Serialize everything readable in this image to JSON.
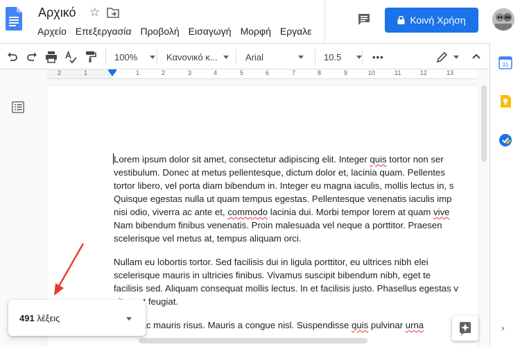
{
  "header": {
    "title": "Αρχικό",
    "menu": [
      "Αρχείο",
      "Επεξεργασία",
      "Προβολή",
      "Εισαγωγή",
      "Μορφή",
      "Εργαλε"
    ],
    "share_label": "Κοινή Χρήση"
  },
  "toolbar": {
    "zoom": "100%",
    "style": "Κανονικό κ...",
    "font": "Arial",
    "font_size": "10.5",
    "more": "•••"
  },
  "ruler": {
    "numbers": [
      "2",
      "1",
      "1",
      "2",
      "3",
      "4",
      "5",
      "6",
      "7",
      "8",
      "9",
      "10",
      "11",
      "12",
      "13"
    ]
  },
  "document": {
    "paragraphs": [
      {
        "lines": [
          [
            "Lorem ipsum dolor sit amet, consectetur adipiscing elit. Integer ",
            {
              "w": "quis"
            },
            " tortor non ser"
          ],
          [
            "vestibulum. Donec at metus pellentesque, dictum dolor et, lacinia quam. Pellentes"
          ],
          [
            "tortor libero, vel porta diam bibendum in. Integer eu magna iaculis, mollis lectus in, s"
          ],
          [
            "Quisque egestas nulla ut quam tempus egestas. Pellentesque venenatis iaculis imp"
          ],
          [
            "nisi odio, viverra ac ante et, ",
            {
              "w": "commodo"
            },
            " lacinia dui. Morbi tempor lorem at quam ",
            {
              "w": "vive"
            }
          ],
          [
            "Nam bibendum finibus venenatis. Proin malesuada vel neque a porttitor. Praesen"
          ],
          [
            "scelerisque vel metus at, tempus aliquam orci."
          ]
        ]
      },
      {
        "lines": [
          [
            "Nullam eu lobortis tortor. Sed facilisis dui in ligula porttitor, eu ultrices nibh elei"
          ],
          [
            "scelerisque mauris in ultricies finibus. Vivamus suscipit bibendum nibh, eget te"
          ],
          [
            "facilisis sed. Aliquam consequat mollis lectus. In et facilisis justo. Phasellus egestas v"
          ],
          [
            "sit amet feugiat."
          ]
        ]
      },
      {
        "lines": [
          [
            "Fusce ac mauris risus. Mauris a congue nisl. Suspendisse ",
            {
              "w": "quis"
            },
            " pulvinar ",
            {
              "w": "urna"
            }
          ]
        ]
      }
    ]
  },
  "word_count": {
    "number": "491",
    "label": "λέξεις"
  },
  "colors": {
    "accent": "#1a73e8",
    "arrow": "#e53935"
  }
}
